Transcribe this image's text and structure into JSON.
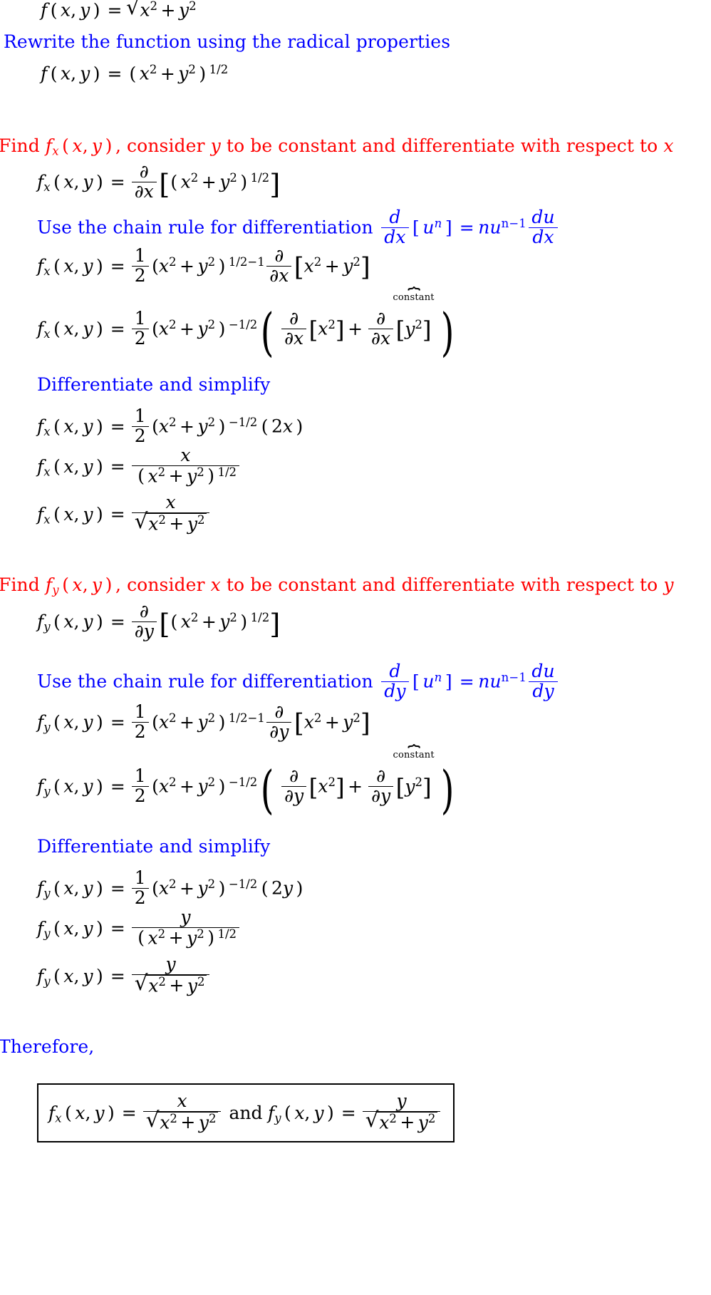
{
  "document": {
    "type": "worked-solution",
    "topic": "Partial derivatives of f(x,y) = sqrt(x^2 + y^2)",
    "colors": {
      "instruction": "#0000ff",
      "heading": "#ff0000",
      "equation": "#000000",
      "background": "#ffffff",
      "box_border": "#000000"
    }
  },
  "steps": {
    "eq_given": "f (x, y) = sqrt(x^2 + y^2)",
    "instr_rewrite": "Rewrite the function using the radical properties",
    "eq_rewritten": "f (x, y) = (x^2 + y^2)^(1/2)",
    "heading_fx": "Find f_x (x, y) , consider y to be constant and differentiate with respect to x",
    "eq_fx_1": "f_x (x, y) = d/dx [(x^2 + y^2)^(1/2)]",
    "instr_chain_x": "Use the chain rule for differentiation",
    "chain_rule_x": "d/dx [u^n] = n u^(n-1) du/dx",
    "eq_fx_2": "f_x (x, y) = 1/2 (x^2 + y^2)^(1/2-1) d/dx [x^2 + y^2]",
    "eq_fx_3": "f_x (x, y) = 1/2 (x^2 + y^2)^(-1/2) ( d/dx [x^2] + d/dx [y^2] )",
    "overbrace_label_x": "constant",
    "instr_simplify_x": "Differentiate and simplify",
    "eq_fx_4": "f_x (x, y) = 1/2 (x^2 + y^2)^(-1/2) (2x)",
    "eq_fx_5": "f_x (x, y) = x / (x^2 + y^2)^(1/2)",
    "eq_fx_6": "f_x (x, y) = x / sqrt(x^2 + y^2)",
    "heading_fy": "Find f_y (x, y) , consider x to be constant and differentiate with respect to y",
    "eq_fy_1": "f_y (x, y) = d/dy [(x^2 + y^2)^(1/2)]",
    "instr_chain_y": "Use the chain rule for differentiation",
    "chain_rule_y": "d/dy [u^n] = n u^(n-1) du/dy",
    "eq_fy_2": "f_y (x, y) = 1/2 (x^2 + y^2)^(1/2-1) d/dy [x^2 + y^2]",
    "eq_fy_3": "f_y (x, y) = 1/2 (x^2 + y^2)^(-1/2) ( d/dy [x^2] + d/dy [y^2] )",
    "overbrace_label_y": "constant",
    "instr_simplify_y": "Differentiate and simplify",
    "eq_fy_4": "f_y (x, y) = 1/2 (x^2 + y^2)^(-1/2) (2y)",
    "eq_fy_5": "f_y (x, y) = y / (x^2 + y^2)^(1/2)",
    "eq_fy_6": "f_y (x, y) = y / sqrt(x^2 + y^2)",
    "therefore": "Therefore,",
    "boxed_answer": "f_x (x, y) = x / sqrt(x^2 + y^2)  and  f_y (x, y) = y / sqrt(x^2 + y^2)"
  },
  "symbols": {
    "f": "f",
    "x": "x",
    "y": "y",
    "u": "u",
    "n": "n",
    "d": "d",
    "partial": "∂",
    "radical": "√",
    "overbrace": "⏞",
    "plus": "+",
    "minus": "−",
    "equals": "=",
    "comma": ",",
    "lparen": "(",
    "rparen": ")",
    "lbrack": "[",
    "rbrack": "]",
    "one": "1",
    "two": "2",
    "and": "and",
    "half": "1/2",
    "neg_half": "−1/2",
    "exp_half_minus_one": "1/2−1",
    "two_x": "2x",
    "two_y": "2y",
    "n_minus_1": "n−1"
  }
}
